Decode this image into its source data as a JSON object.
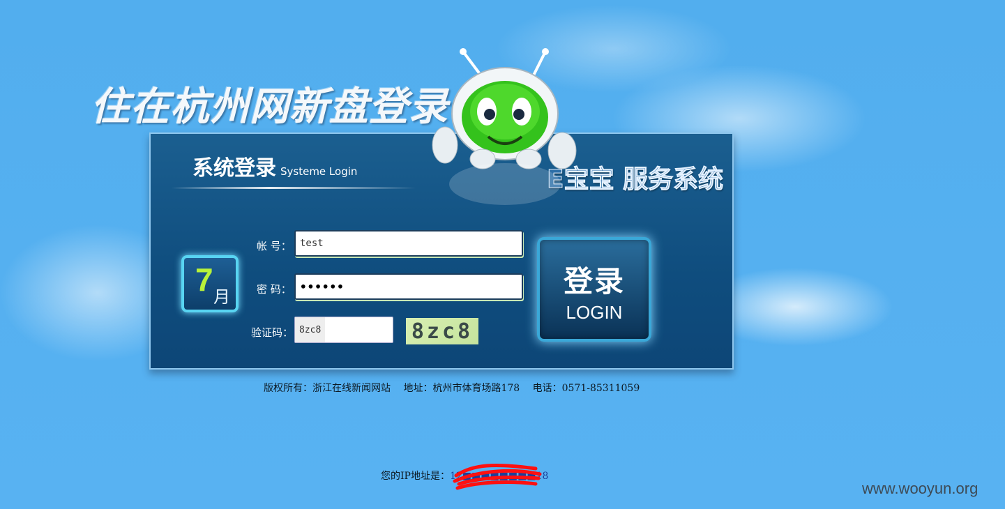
{
  "page": {
    "title": "住在杭州网新盘登录",
    "watermark": "www.wooyun.org"
  },
  "panel": {
    "title_cn": "系统登录",
    "title_en": "Systeme Login",
    "service_title": "E宝宝 服务系统",
    "calendar": {
      "day": "7",
      "month": "月"
    }
  },
  "form": {
    "account_label": "帐 号：",
    "account_value": "test",
    "password_label": "密 码：",
    "password_value": "••••••",
    "captcha_label": "验证码：",
    "captcha_value": "8zc8",
    "captcha_image_text": "8zc8",
    "login_button_cn": "登录",
    "login_button_en": "LOGIN"
  },
  "footer": {
    "copyright": "版权所有：浙江在线新闻网站　 地址：杭州市体育场路178　 电话：0571-85311059",
    "ip_label": "您的IP地址是：",
    "ip_value": "12■■■■■■■■18"
  },
  "colors": {
    "background": "#55aef0",
    "panel": "#0f4d7e",
    "accent": "#58d4f2",
    "redaction": "#ff0000"
  },
  "icons": {
    "mascot": "robot-mascot-icon",
    "calendar": "calendar-icon"
  }
}
